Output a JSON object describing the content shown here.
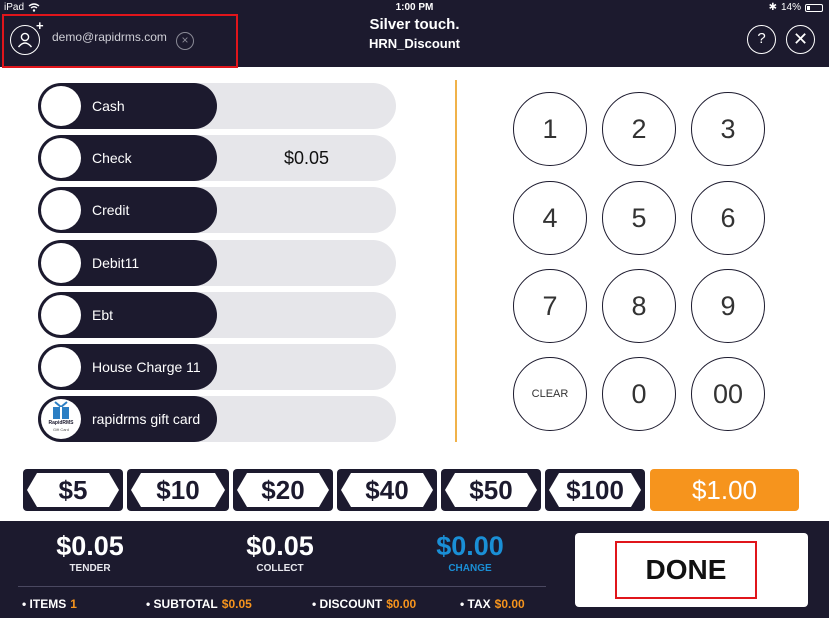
{
  "status": {
    "device": "iPad",
    "time": "1:00 PM",
    "battery": "14%"
  },
  "header": {
    "title": "Silver touch.",
    "subtitle": "HRN_Discount",
    "customer_email": "demo@rapidrms.com",
    "help": "?",
    "close": "✕"
  },
  "tenders": [
    {
      "label": "Cash",
      "amount": ""
    },
    {
      "label": "Check",
      "amount": "$0.05"
    },
    {
      "label": "Credit",
      "amount": ""
    },
    {
      "label": "Debit11",
      "amount": ""
    },
    {
      "label": "Ebt",
      "amount": ""
    },
    {
      "label": "House Charge 11",
      "amount": ""
    },
    {
      "label": "rapidrms gift card",
      "amount": "",
      "logo_text": "RapidRMS",
      "logo_sub": "Gift Card"
    }
  ],
  "keypad": [
    "1",
    "2",
    "3",
    "4",
    "5",
    "6",
    "7",
    "8",
    "9",
    "CLEAR",
    "0",
    "00"
  ],
  "quick_cash": [
    "$5",
    "$10",
    "$20",
    "$40",
    "$50",
    "$100"
  ],
  "entered_amount": "$1.00",
  "summary": {
    "tender": {
      "value": "$0.05",
      "label": "TENDER"
    },
    "collect": {
      "value": "$0.05",
      "label": "COLLECT"
    },
    "change": {
      "value": "$0.00",
      "label": "CHANGE"
    }
  },
  "footer": {
    "items_label": "• ITEMS",
    "items": "1",
    "subtotal_label": "• SUBTOTAL",
    "subtotal": "$0.05",
    "discount_label": "• DISCOUNT",
    "discount": "$0.00",
    "tax_label": "• TAX",
    "tax": "$0.00"
  },
  "done_label": "DONE",
  "colors": {
    "navy": "#1c1a2e",
    "orange": "#f6941d",
    "change_blue": "#1a8fd6",
    "highlight_red": "#e0151b"
  }
}
